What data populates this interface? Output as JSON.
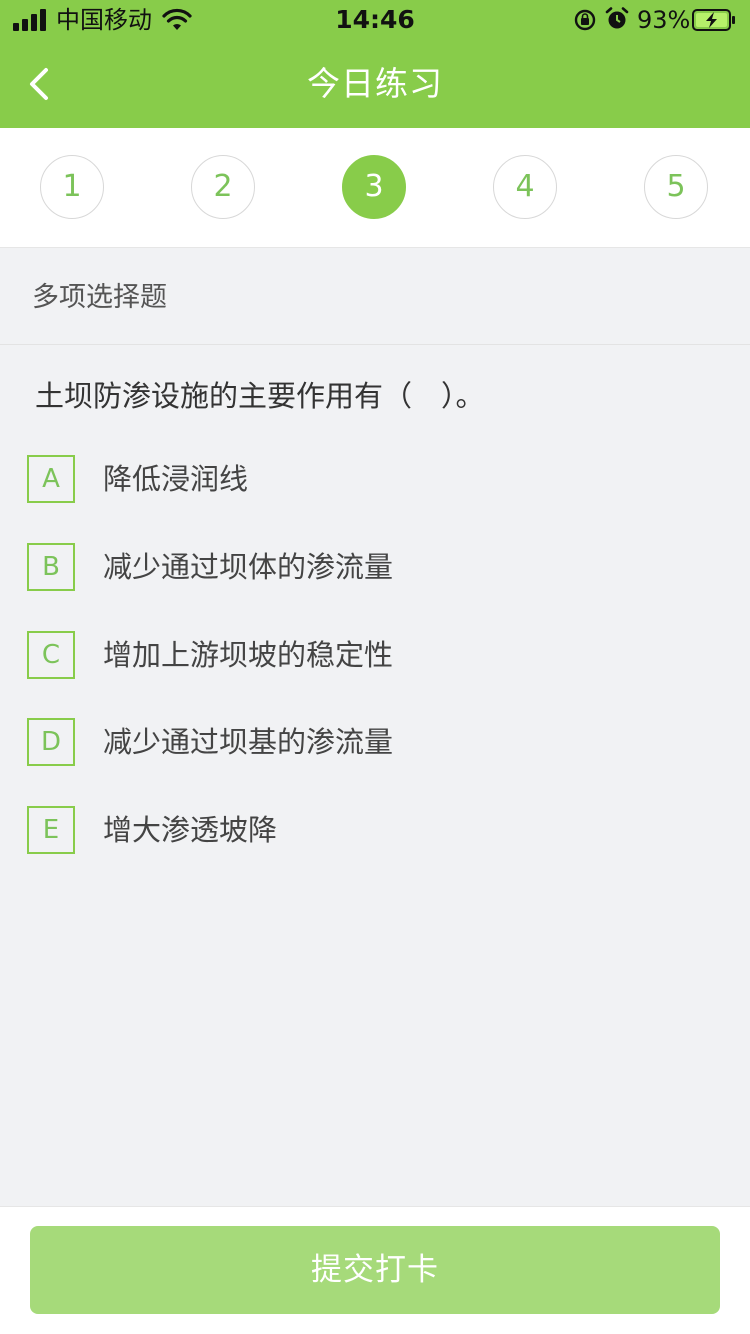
{
  "status_bar": {
    "carrier": "中国移动",
    "time": "14:46",
    "battery_percent": "93%",
    "icons": [
      "signal-icon",
      "wifi-icon",
      "orientation-lock-icon",
      "alarm-icon",
      "battery-charging-icon"
    ]
  },
  "nav": {
    "back_icon": "chevron-left-icon",
    "title": "今日练习"
  },
  "steps": {
    "items": [
      "1",
      "2",
      "3",
      "4",
      "5"
    ],
    "active": "3"
  },
  "question": {
    "type": "多项选择题",
    "text": "土坝防渗设施的主要作用有（　）。",
    "options": [
      {
        "letter": "A",
        "text": "降低浸润线"
      },
      {
        "letter": "B",
        "text": "减少通过坝体的渗流量"
      },
      {
        "letter": "C",
        "text": "增加上游坝坡的稳定性"
      },
      {
        "letter": "D",
        "text": "减少通过坝基的渗流量"
      },
      {
        "letter": "E",
        "text": "增大渗透坡降"
      }
    ]
  },
  "footer": {
    "submit_label": "提交打卡"
  },
  "colors": {
    "accent": "#88cc4a",
    "button": "#a6da7a",
    "background": "#f1f2f4"
  }
}
